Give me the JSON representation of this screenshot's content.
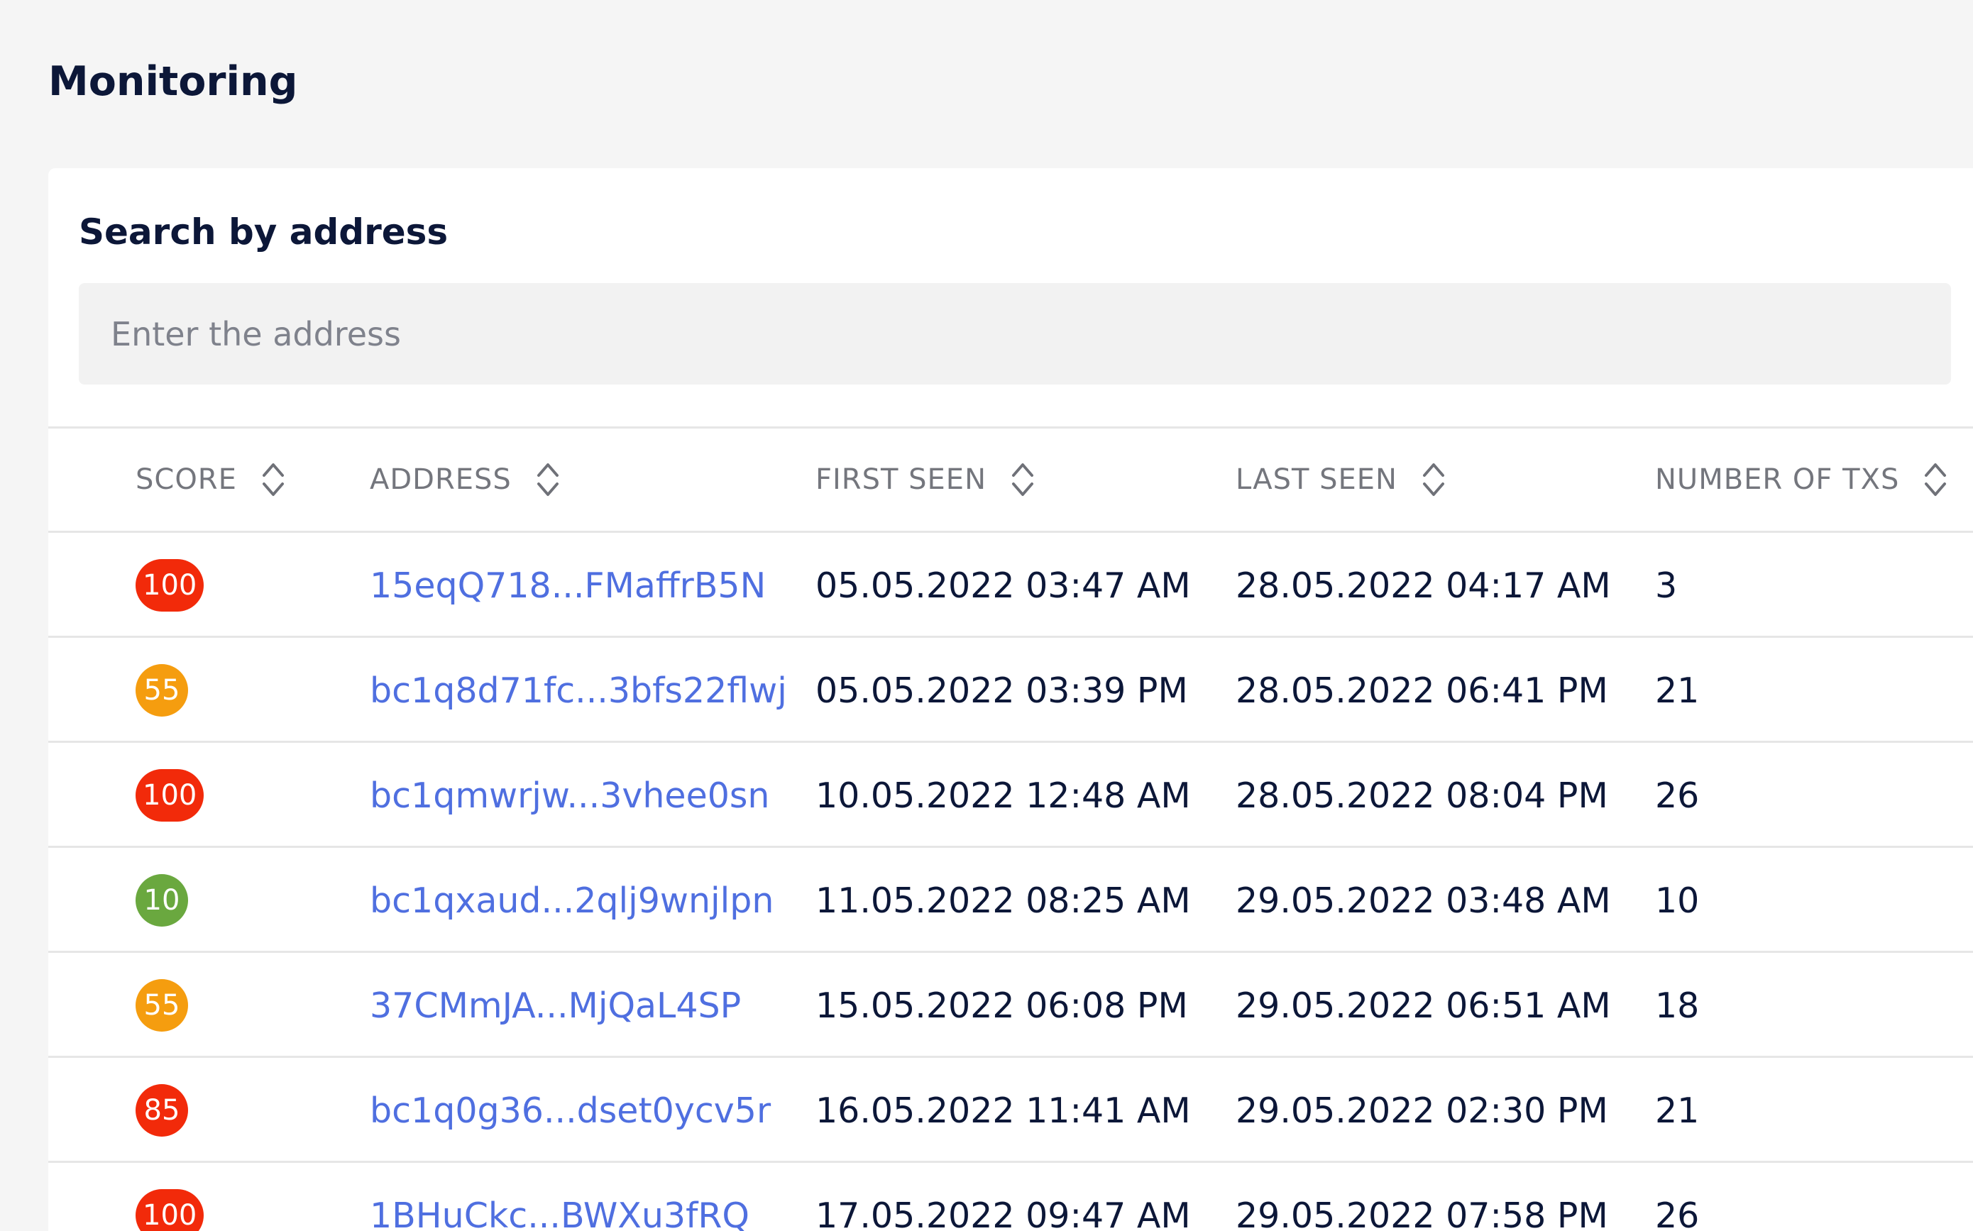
{
  "page": {
    "title": "Monitoring"
  },
  "search": {
    "label": "Search by address",
    "placeholder": "Enter the address",
    "value": ""
  },
  "table": {
    "columns": [
      {
        "key": "score",
        "label": "SCORE"
      },
      {
        "key": "address",
        "label": "ADDRESS"
      },
      {
        "key": "first_seen",
        "label": "FIRST SEEN"
      },
      {
        "key": "last_seen",
        "label": "LAST SEEN"
      },
      {
        "key": "num_txs",
        "label": "NUMBER OF TXS"
      }
    ],
    "rows": [
      {
        "score": "100",
        "score_color": "#f22a0a",
        "address": "15eqQ718...FMaffrB5N",
        "first_seen": "05.05.2022 03:47 AM",
        "last_seen": "28.05.2022 04:17 AM",
        "num_txs": "3"
      },
      {
        "score": "55",
        "score_color": "#f59d0f",
        "address": "bc1q8d71fc...3bfs22flwj",
        "first_seen": "05.05.2022 03:39 PM",
        "last_seen": "28.05.2022 06:41 PM",
        "num_txs": "21"
      },
      {
        "score": "100",
        "score_color": "#f22a0a",
        "address": "bc1qmwrjw...3vhee0sn",
        "first_seen": "10.05.2022 12:48 AM",
        "last_seen": "28.05.2022 08:04 PM",
        "num_txs": "26"
      },
      {
        "score": "10",
        "score_color": "#6aa83f",
        "address": "bc1qxaud...2qlj9wnjlpn",
        "first_seen": "11.05.2022 08:25 AM",
        "last_seen": "29.05.2022 03:48 AM",
        "num_txs": "10"
      },
      {
        "score": "55",
        "score_color": "#f59d0f",
        "address": "37CMmJA...MjQaL4SP",
        "first_seen": "15.05.2022 06:08 PM",
        "last_seen": "29.05.2022 06:51 AM",
        "num_txs": "18"
      },
      {
        "score": "85",
        "score_color": "#f22a0a",
        "address": "bc1q0g36...dset0ycv5r",
        "first_seen": "16.05.2022 11:41 AM",
        "last_seen": "29.05.2022 02:30 PM",
        "num_txs": "21"
      },
      {
        "score": "100",
        "score_color": "#f22a0a",
        "address": "1BHuCkc...BWXu3fRQ",
        "first_seen": "17.05.2022 09:47 AM",
        "last_seen": "29.05.2022 07:58 PM",
        "num_txs": "26"
      }
    ]
  },
  "icons": {
    "sort": "sort-icon"
  }
}
